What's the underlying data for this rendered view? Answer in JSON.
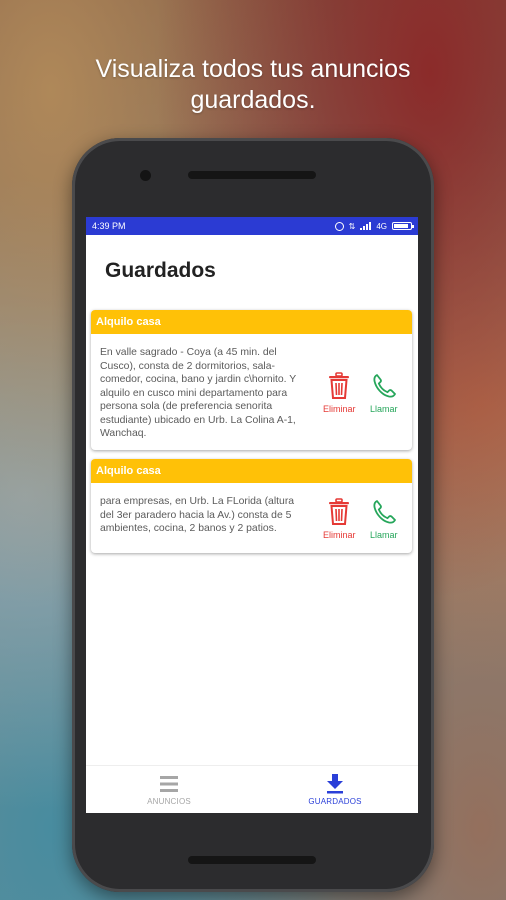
{
  "headline": {
    "line1": "Visualiza todos tus anuncios",
    "line2": "guardados."
  },
  "statusbar": {
    "time": "4:39 PM",
    "network": "4G",
    "color": "#2b3bd3"
  },
  "page": {
    "title": "Guardados"
  },
  "cards": [
    {
      "title": "Alquilo casa",
      "description": "En valle sagrado - Coya (a 45 min. del Cusco), consta de 2 dormitorios, sala-comedor, cocina, bano y jardin c\\hornito. Y alquilo en cusco mini departamento para persona sola (de preferencia senorita estudiante) ubicado en Urb. La Colina A-1, Wanchaq.",
      "delete_label": "Eliminar",
      "call_label": "Llamar"
    },
    {
      "title": "Alquilo casa",
      "description": "para empresas, en Urb. La FLorida (altura del 3er paradero hacia la Av.) consta de 5 ambientes, cocina, 2 banos y 2 patios.",
      "delete_label": "Eliminar",
      "call_label": "Llamar"
    }
  ],
  "bottom_nav": {
    "items": [
      {
        "label": "ANUNCIOS",
        "icon": "list-icon",
        "active": false
      },
      {
        "label": "GUARDADOS",
        "icon": "download-icon",
        "active": true
      }
    ]
  },
  "colors": {
    "card_header": "#ffc107",
    "delete": "#e53935",
    "call": "#26a65b",
    "active_nav": "#2a3fd8",
    "inactive_nav": "#a6a6a6"
  }
}
